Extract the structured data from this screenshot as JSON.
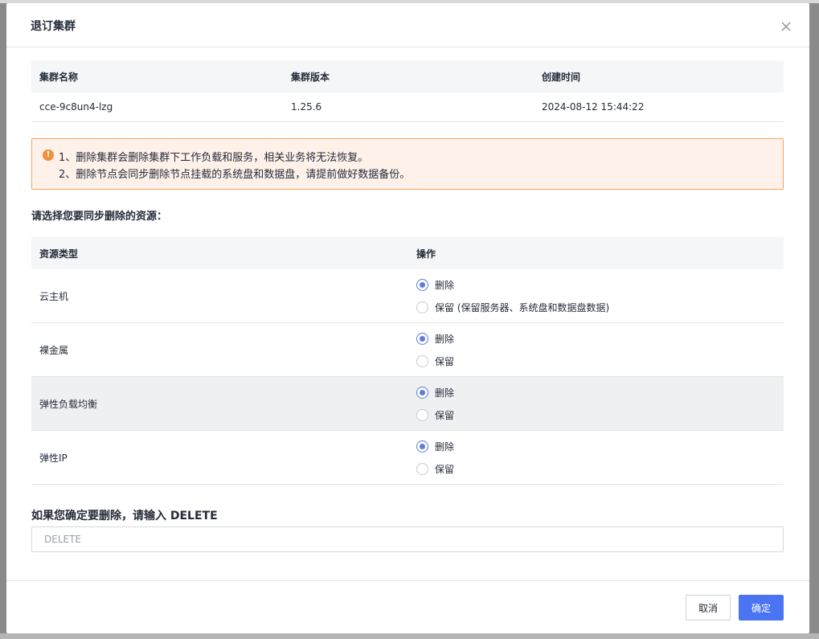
{
  "dialog": {
    "title": "退订集群",
    "close_icon": "close-icon"
  },
  "cluster_table": {
    "headers": [
      "集群名称",
      "集群版本",
      "创建时间"
    ],
    "row": [
      "cce-9c8un4-lzg",
      "1.25.6",
      "2024-08-12 15:44:22"
    ]
  },
  "warning": {
    "icon": "warning-icon",
    "line1": "1、删除集群会删除集群下工作负载和服务，相关业务将无法恢复。",
    "line2": "2、删除节点会同步删除节点挂载的系统盘和数据盘，请提前做好数据备份。"
  },
  "select_label": "请选择您要同步删除的资源：",
  "resource_table": {
    "headers": [
      "资源类型",
      "操作"
    ],
    "rows": [
      {
        "type": "云主机",
        "options": [
          "删除",
          "保留 (保留服务器、系统盘和数据盘数据)"
        ],
        "selected": "删除"
      },
      {
        "type": "裸金属",
        "options": [
          "删除",
          "保留"
        ],
        "selected": "删除"
      },
      {
        "type": "弹性负载均衡",
        "options": [
          "删除",
          "保留"
        ],
        "selected": "删除"
      },
      {
        "type": "弹性IP",
        "options": [
          "删除",
          "保留"
        ],
        "selected": "删除"
      }
    ]
  },
  "confirm": {
    "label": "如果您确定要删除，请输入 DELETE",
    "placeholder": "DELETE",
    "value": ""
  },
  "footer": {
    "cancel_label": "取消",
    "ok_label": "确定"
  },
  "colors": {
    "primary": "#4a74f2",
    "radio_selected": "#5e7ce0",
    "warning_bg": "#fef1e9",
    "warning_border": "#f4a461",
    "warning_icon": "#f18f3b"
  }
}
